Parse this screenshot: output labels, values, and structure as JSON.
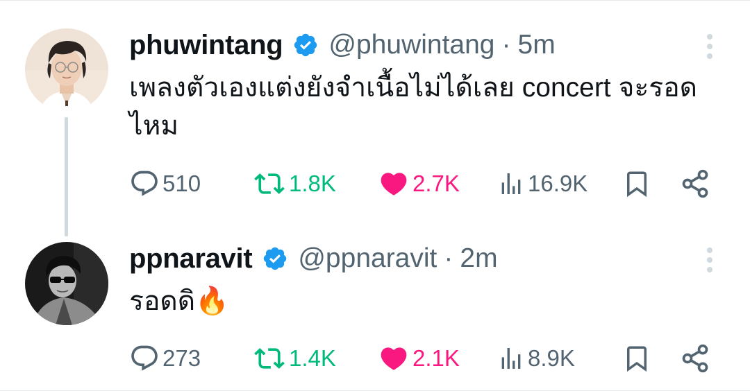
{
  "colors": {
    "verified": "#1d9bf0",
    "retweet_active": "#00ba7c",
    "like_active": "#f91880",
    "secondary_text": "#536471",
    "thread_line": "#cfd9de"
  },
  "tweets": [
    {
      "name": "phuwintang",
      "handle": "@phuwintang",
      "separator": "·",
      "time": "5m",
      "verified": true,
      "text": "เพลงตัวเองแต่งยังจำเนื้อไม่ได้เลย concert จะรอดไหม",
      "avatar_icon": "user-photo-avatar",
      "stats": {
        "replies": "510",
        "retweets": "1.8K",
        "likes": "2.7K",
        "views": "16.9K"
      },
      "retweeted": true,
      "liked": true
    },
    {
      "name": "ppnaravit",
      "handle": "@ppnaravit",
      "separator": "·",
      "time": "2m",
      "verified": true,
      "text": "รอดดิ🔥",
      "avatar_icon": "user-photo-avatar-bw",
      "stats": {
        "replies": "273",
        "retweets": "1.4K",
        "likes": "2.1K",
        "views": "8.9K"
      },
      "retweeted": true,
      "liked": true
    }
  ],
  "icons": {
    "more": "more-vertical-icon",
    "reply": "reply-bubble-icon",
    "retweet": "retweet-icon",
    "like": "heart-icon",
    "views": "views-bar-chart-icon",
    "bookmark": "bookmark-icon",
    "share": "share-icon",
    "verified": "verified-badge-icon"
  }
}
